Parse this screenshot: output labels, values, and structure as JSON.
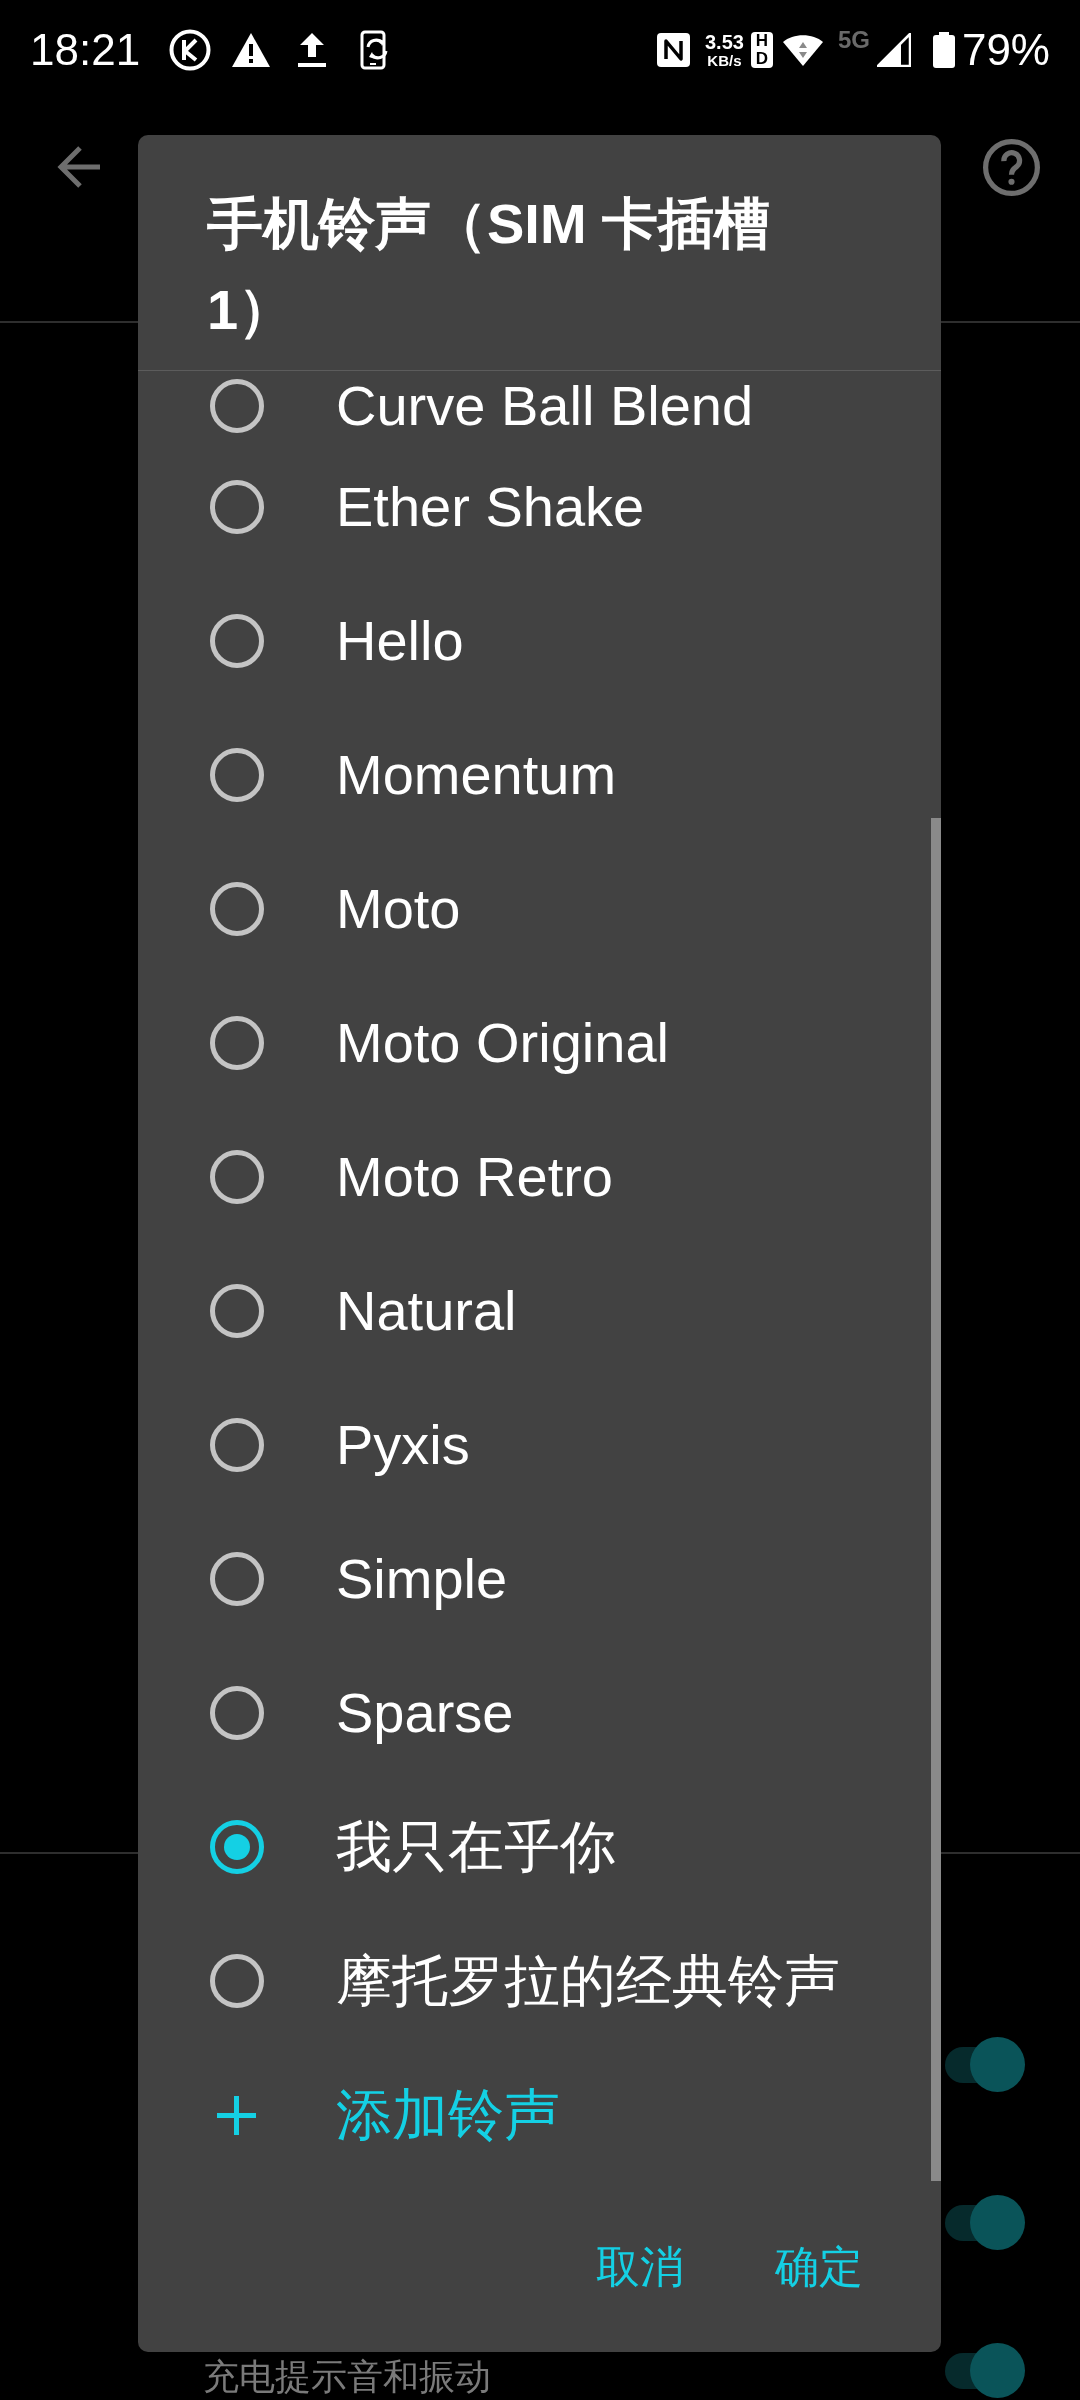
{
  "status_bar": {
    "time": "18:21",
    "net_speed": {
      "value": "3.53",
      "unit": "KB/s"
    },
    "hd_badge": "HD",
    "network_type": {
      "label": "5G",
      "active": false
    },
    "battery": "79%"
  },
  "settings": [
    {
      "on": true
    },
    {
      "on": true
    },
    {
      "label": "充电提示音和振动",
      "on": true
    }
  ],
  "dialog": {
    "title": "手机铃声（SIM 卡插槽 1）",
    "options": [
      {
        "label": "Curve Ball Blend",
        "selected": false
      },
      {
        "label": "Ether Shake",
        "selected": false
      },
      {
        "label": "Hello",
        "selected": false
      },
      {
        "label": "Momentum",
        "selected": false
      },
      {
        "label": "Moto",
        "selected": false
      },
      {
        "label": "Moto Original",
        "selected": false
      },
      {
        "label": "Moto Retro",
        "selected": false
      },
      {
        "label": "Natural",
        "selected": false
      },
      {
        "label": "Pyxis",
        "selected": false
      },
      {
        "label": "Simple",
        "selected": false
      },
      {
        "label": "Sparse",
        "selected": false
      },
      {
        "label": "我只在乎你",
        "selected": true
      },
      {
        "label": "摩托罗拉的经典铃声",
        "selected": false
      }
    ],
    "add_action": "添加铃声",
    "buttons": [
      "取消",
      "确定"
    ]
  }
}
